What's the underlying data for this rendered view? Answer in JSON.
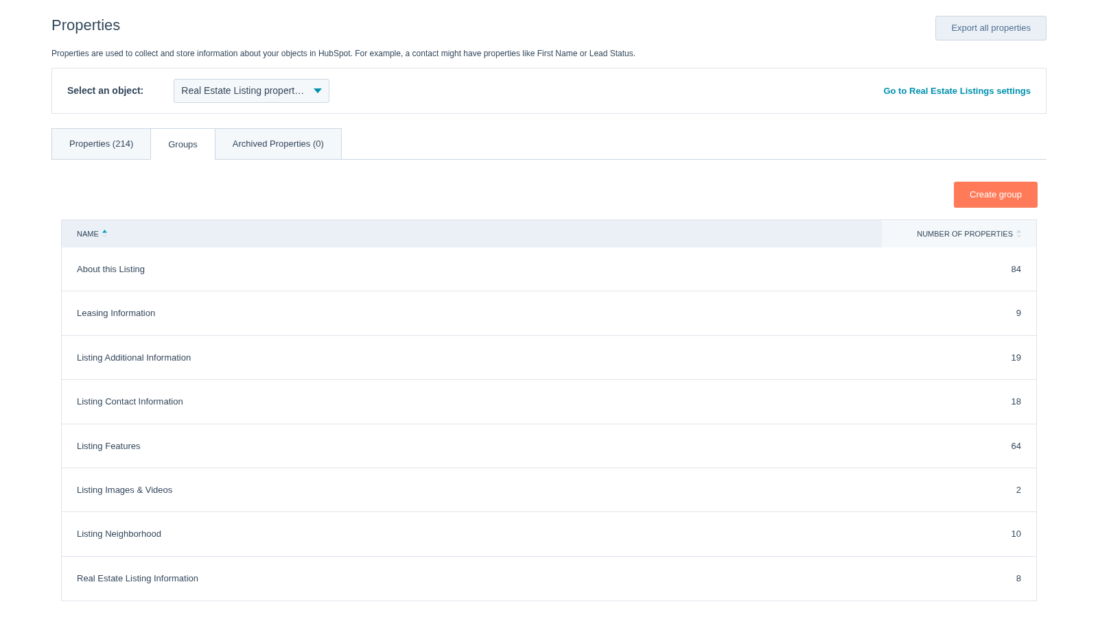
{
  "page": {
    "title": "Properties",
    "description": "Properties are used to collect and store information about your objects in HubSpot. For example, a contact might have properties like First Name or Lead Status.",
    "export_button": "Export all properties"
  },
  "object_selector": {
    "label": "Select an object:",
    "value": "Real Estate Listing propert…",
    "settings_link": "Go to Real Estate Listings settings"
  },
  "tabs": [
    {
      "label": "Properties (214)",
      "selected": false
    },
    {
      "label": "Groups",
      "selected": true
    },
    {
      "label": "Archived Properties (0)",
      "selected": false
    }
  ],
  "create_button": "Create group",
  "table": {
    "columns": [
      {
        "label": "NAME",
        "sorted": true
      },
      {
        "label": "NUMBER OF PROPERTIES",
        "sorted": false
      }
    ],
    "rows": [
      {
        "name": "About this Listing",
        "count": "84"
      },
      {
        "name": "Leasing Information",
        "count": "9"
      },
      {
        "name": "Listing Additional Information",
        "count": "19"
      },
      {
        "name": "Listing Contact Information",
        "count": "18"
      },
      {
        "name": "Listing Features",
        "count": "64"
      },
      {
        "name": "Listing Images & Videos",
        "count": "2"
      },
      {
        "name": "Listing Neighborhood",
        "count": "10"
      },
      {
        "name": "Real Estate Listing Information",
        "count": "8"
      }
    ]
  }
}
